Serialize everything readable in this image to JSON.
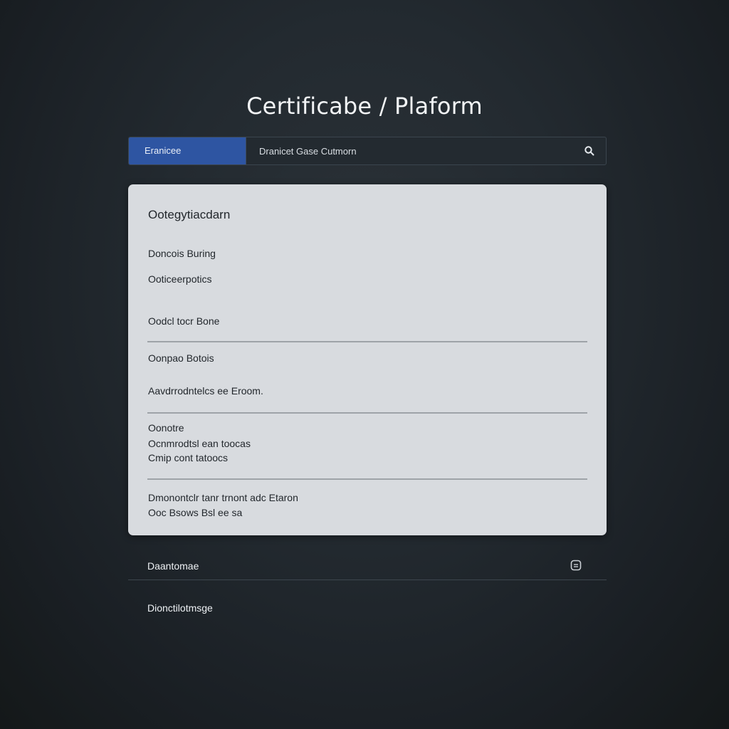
{
  "page": {
    "title": "Certificabe / Plaform"
  },
  "search": {
    "scope_label": "Eranicee",
    "placeholder": "Dranicet Gase Cutmorn",
    "icon": "search-icon"
  },
  "details_card": {
    "heading": "Ootegytiacdarn",
    "rows": [
      {
        "text": "Doncois Buring"
      },
      {
        "text": "Ooticeerpotics"
      },
      {
        "text": "Oodcl tocr Bone"
      },
      {
        "text": "Oonpao Botois"
      },
      {
        "text": "Aavdrrodntelcs ee Eroom."
      },
      {
        "text": "Oonotre"
      },
      {
        "text": "Ocnmrodtsl ean toocas"
      },
      {
        "text": "Cmip cont tatoocs"
      },
      {
        "text": "Dmonontclr tanr trnont adc Etaron"
      },
      {
        "text": "Ooc Bsows Bsl ee sa"
      }
    ]
  },
  "bottom_rows": [
    {
      "label": "Daantomae",
      "icon": "document-icon"
    },
    {
      "label": "Dionctilotmsge"
    }
  ],
  "colors": {
    "background": "#1f252a",
    "accent": "#2e55a2",
    "card": "#d8dbdf"
  }
}
